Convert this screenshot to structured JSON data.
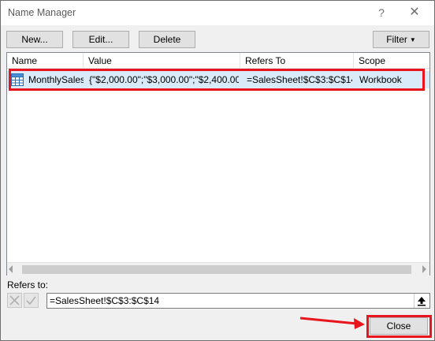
{
  "window": {
    "title": "Name Manager",
    "help_label": "?",
    "close_label": "✕"
  },
  "toolbar": {
    "new_label": "New...",
    "edit_label": "Edit...",
    "delete_label": "Delete",
    "filter_label": "Filter"
  },
  "list": {
    "columns": [
      "Name",
      "Value",
      "Refers To",
      "Scope"
    ],
    "rows": [
      {
        "icon": "table-icon",
        "name": "MonthlySales",
        "value": "{\"$2,000.00\";\"$3,000.00\";\"$2,400.00\"...",
        "refers_to": "=SalesSheet!$C$3:$C$14",
        "scope": "Workbook"
      }
    ]
  },
  "refers": {
    "label": "Refers to:",
    "value": "=SalesSheet!$C$3:$C$14"
  },
  "footer": {
    "close_label": "Close"
  },
  "colors": {
    "highlight": "#e8141e",
    "selection": "#d9ebf9"
  }
}
